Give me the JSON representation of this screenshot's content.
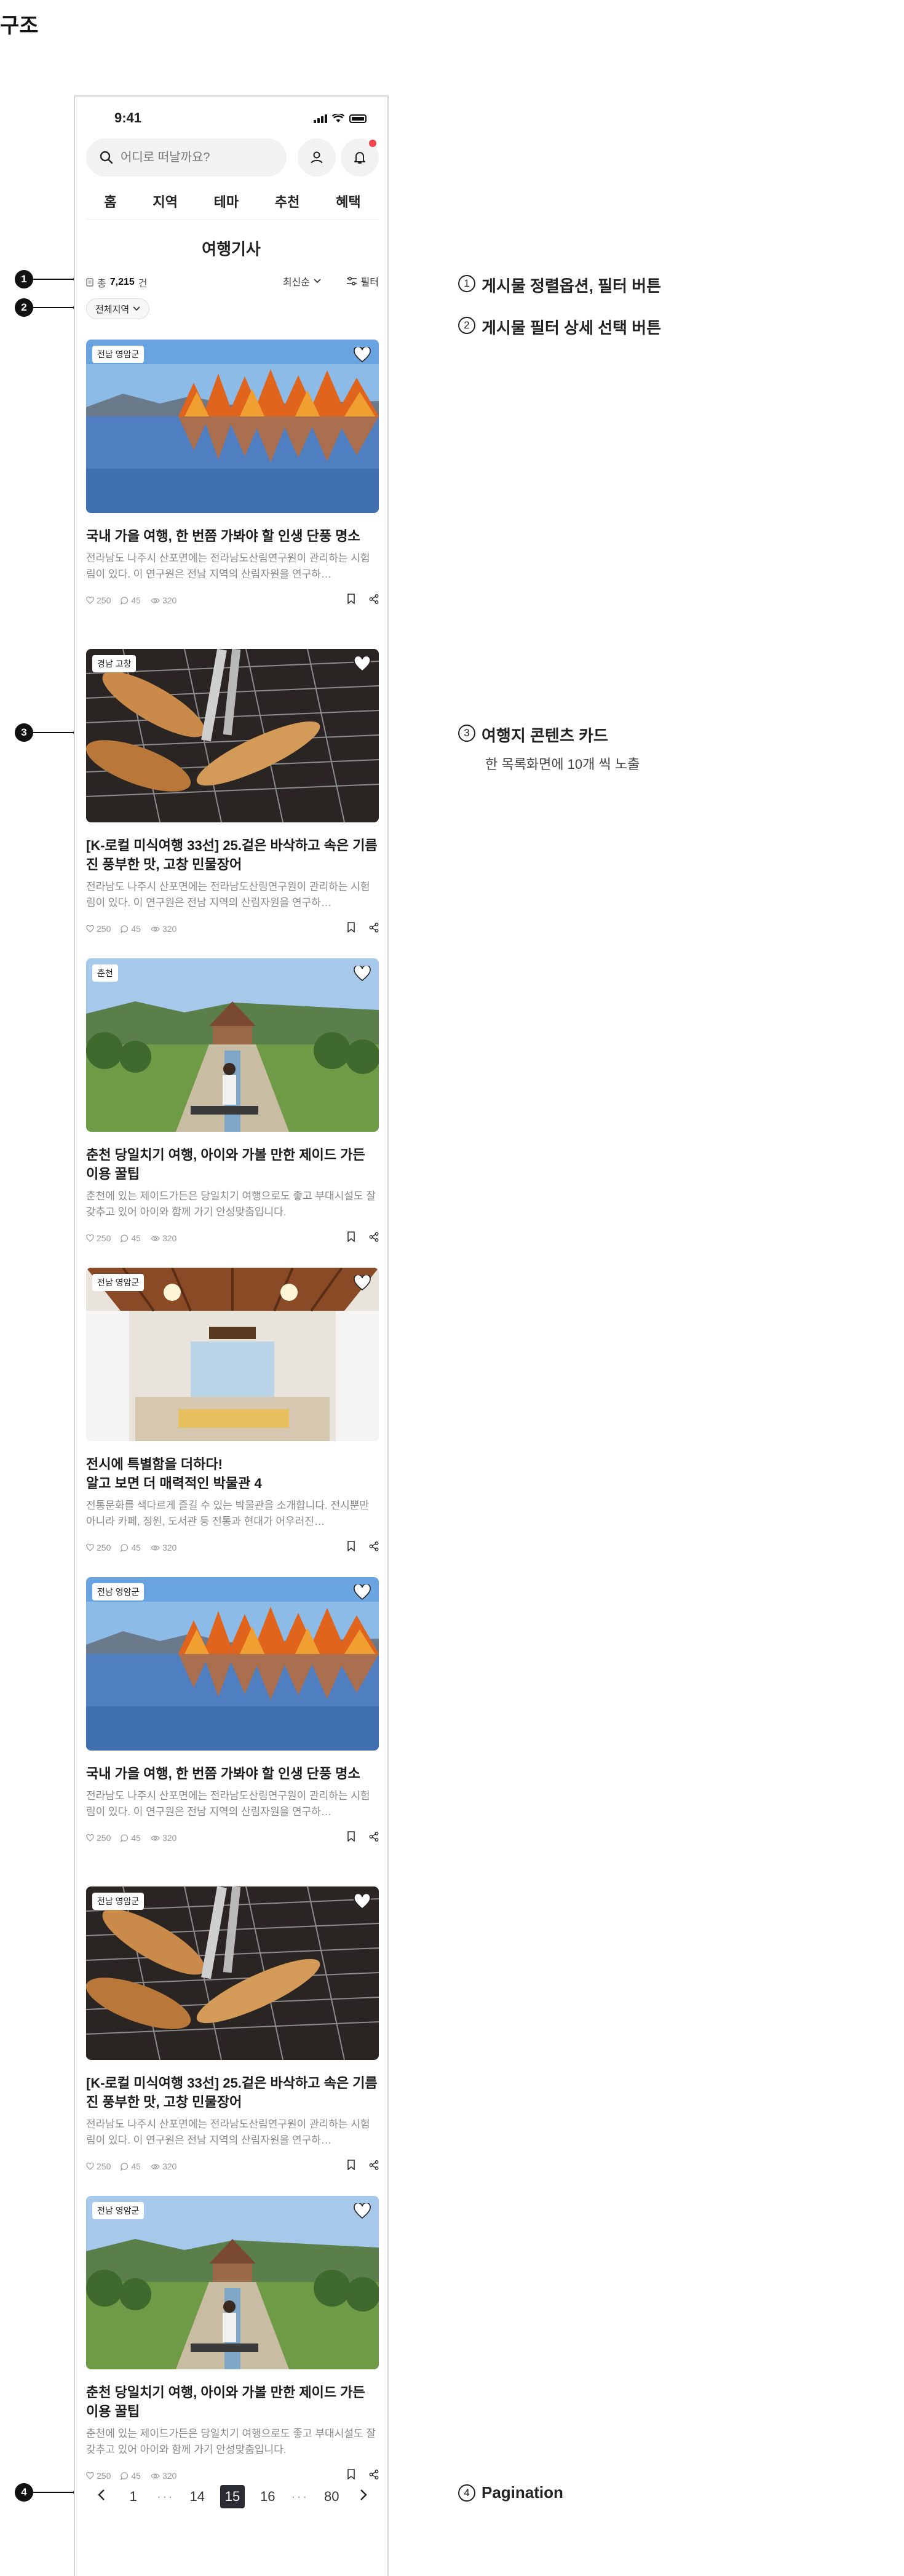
{
  "page": {
    "heading": "구조"
  },
  "status": {
    "time": "9:41"
  },
  "search": {
    "placeholder": "어디로 떠날까요?"
  },
  "nav": [
    "홈",
    "지역",
    "테마",
    "추천",
    "혜택"
  ],
  "list": {
    "title": "여행기사",
    "count_prefix": "총",
    "count": "7,215",
    "count_unit": "건",
    "sort_label": "최신순",
    "filter_label": "필터",
    "region_chip": "전체지역"
  },
  "colors": {
    "accent_dot": "#f0454c",
    "current_page_bg": "#2b2b33"
  },
  "cards": [
    {
      "badge": "전남 영암군",
      "image": "autumn-lake",
      "title": "국내 가을 여행, 한 번쯤 가봐야 할 인생 단풍 명소",
      "desc": "전라남도 나주시 산포면에는 전라남도산림연구원이 관리하는 시험림이 있다. 이 연구원은 전남 지역의 산림자원을 연구하…",
      "likes": "250",
      "comments": "45",
      "views": "320"
    },
    {
      "badge": "경남 고창",
      "image": "grilled-eel",
      "title": "[K-로컬 미식여행 33선] 25.겉은 바삭하고 속은 기름진 풍부한 맛, 고창 민물장어",
      "desc": "전라남도 나주시 산포면에는 전라남도산림연구원이 관리하는 시험림이 있다. 이 연구원은 전남 지역의 산림자원을 연구하…",
      "likes": "250",
      "comments": "45",
      "views": "320"
    },
    {
      "badge": "춘천",
      "image": "garden-path",
      "title": "춘천 당일치기 여행, 아이와 가볼 만한 제이드 가든 이용 꿀팁",
      "desc": "춘천에 있는 제이드가든은 당일치기 여행으로도 좋고 부대시설도 잘 갖추고 있어 아이와 함께 가기 안성맞춤입니다.",
      "likes": "250",
      "comments": "45",
      "views": "320"
    },
    {
      "badge": "전남 영암군",
      "image": "museum-interior",
      "title": "전시에 특별함을 더하다!\n알고 보면 더 매력적인 박물관 4",
      "desc": "전통문화를 색다르게 즐길 수 있는 박물관을 소개합니다. 전시뿐만 아니라 카페, 정원, 도서관 등 전통과 현대가 어우러진…",
      "likes": "250",
      "comments": "45",
      "views": "320"
    },
    {
      "badge": "전남 영암군",
      "image": "autumn-lake",
      "title": "국내 가을 여행, 한 번쯤 가봐야 할 인생 단풍 명소",
      "desc": "전라남도 나주시 산포면에는 전라남도산림연구원이 관리하는 시험림이 있다. 이 연구원은 전남 지역의 산림자원을 연구하…",
      "likes": "250",
      "comments": "45",
      "views": "320"
    },
    {
      "badge": "전남 영암군",
      "image": "grilled-eel",
      "title": "[K-로컬 미식여행 33선] 25.겉은 바삭하고 속은 기름진 풍부한 맛, 고창 민물장어",
      "desc": "전라남도 나주시 산포면에는 전라남도산림연구원이 관리하는 시험림이 있다. 이 연구원은 전남 지역의 산림자원을 연구하…",
      "likes": "250",
      "comments": "45",
      "views": "320"
    },
    {
      "badge": "전남 영암군",
      "image": "garden-path",
      "title": "춘천 당일치기 여행, 아이와 가볼 만한 제이드 가든 이용 꿀팁",
      "desc": "춘천에 있는 제이드가든은 당일치기 여행으로도 좋고 부대시설도 잘 갖추고 있어 아이와 함께 가기 안성맞춤입니다.",
      "likes": "250",
      "comments": "45",
      "views": "320"
    }
  ],
  "pagination": {
    "prev": "‹",
    "pages": [
      "1",
      "···",
      "14",
      "15",
      "16",
      "···",
      "80"
    ],
    "current": "15",
    "next": "›"
  },
  "annotations": [
    {
      "num": "1",
      "text": "게시물 정렬옵션, 필터 버튼"
    },
    {
      "num": "2",
      "text": "게시물 필터 상세 선택 버튼"
    },
    {
      "num": "3",
      "text": "여행지 콘텐츠 카드",
      "sub": "한 목록화면에 10개 씩 노출"
    },
    {
      "num": "4",
      "text": "Pagination"
    }
  ]
}
